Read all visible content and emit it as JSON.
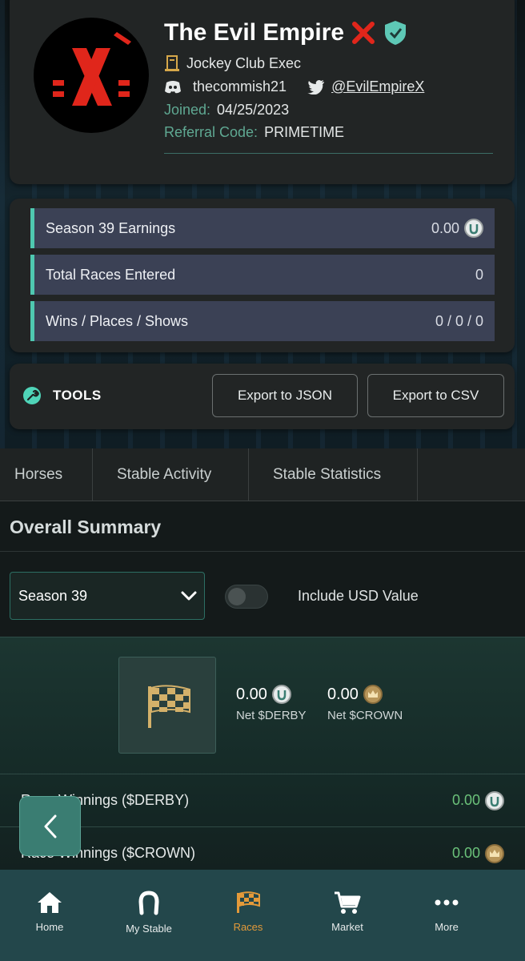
{
  "profile": {
    "name": "The Evil Empire",
    "rank": "Jockey Club Exec",
    "discord": "thecommish21",
    "twitter": "@EvilEmpireX",
    "joined_label": "Joined:",
    "joined_value": "04/25/2023",
    "referral_label": "Referral Code:",
    "referral_value": "PRIMETIME"
  },
  "stats": [
    {
      "label": "Season 39 Earnings",
      "value": "0.00",
      "icon": "derby-coin-icon"
    },
    {
      "label": "Total Races Entered",
      "value": "0"
    },
    {
      "label": "Wins / Places / Shows",
      "value": "0 / 0 / 0"
    }
  ],
  "tools": {
    "label": "TOOLS",
    "export_json": "Export to JSON",
    "export_csv": "Export to CSV"
  },
  "tabs": [
    "Horses",
    "Stable Activity",
    "Stable Statistics"
  ],
  "summary": {
    "title": "Overall Summary",
    "season_select": "Season 39",
    "usd_toggle_label": "Include USD Value",
    "usd_toggle_on": false,
    "net_derby_value": "0.00",
    "net_derby_label": "Net $DERBY",
    "net_crown_value": "0.00",
    "net_crown_label": "Net $CROWN",
    "rows": [
      {
        "label": "Race Winnings ($DERBY)",
        "value": "0.00"
      },
      {
        "label": "Race Winnings ($CROWN)",
        "value": "0.00"
      }
    ]
  },
  "nav": [
    {
      "label": "Home",
      "icon": "home-icon"
    },
    {
      "label": "My Stable",
      "icon": "horseshoe-icon"
    },
    {
      "label": "Races",
      "icon": "checkered-flag-icon",
      "active": true
    },
    {
      "label": "Market",
      "icon": "cart-icon"
    },
    {
      "label": "More",
      "icon": "more-dots-icon"
    }
  ],
  "colors": {
    "accent": "#4fc8b0",
    "active_nav": "#e39a3a",
    "win_green": "#6bc27a",
    "brand_red": "#e0261b"
  }
}
